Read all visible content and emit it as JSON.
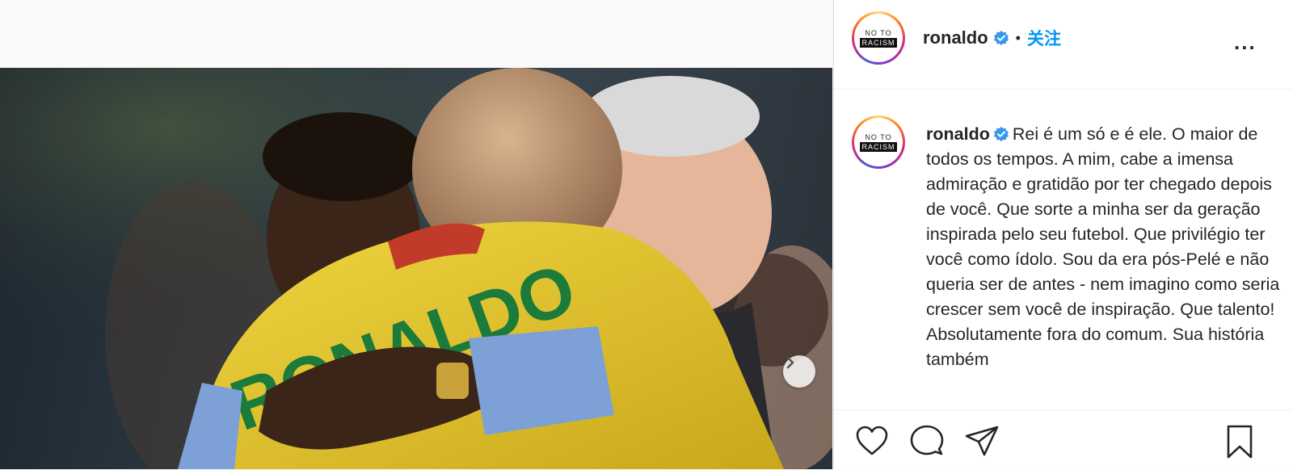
{
  "post": {
    "username": "ronaldo",
    "follow_label": "关注",
    "separator": "•",
    "more_label": "...",
    "avatar_badge": {
      "top": "NO TO",
      "bottom": "RACISM"
    },
    "caption_text": "Rei é um só e é ele. O maior de todos os tempos. A mim, cabe a imensa admiração e gratidão por ter chegado depois de você. Que sorte a minha ser da geração inspirada pelo seu futebol. Que privilégio ter você como ídolo. Sou da era pós-Pelé e não queria ser de antes - nem imagino como seria crescer sem você de inspiração. Que talento! Absolutamente fora do comum. Sua história também",
    "photo_jersey_text": "RONALDO"
  },
  "icons": {
    "verified": "verified-badge-icon",
    "next": "chevron-right-icon",
    "like": "heart-icon",
    "comment": "comment-icon",
    "share": "paper-plane-icon",
    "save": "bookmark-icon"
  },
  "colors": {
    "accent": "#0095f6",
    "verified": "#3897f0",
    "jersey": "#e8c72a",
    "jersey_text": "#1c7a3a"
  }
}
